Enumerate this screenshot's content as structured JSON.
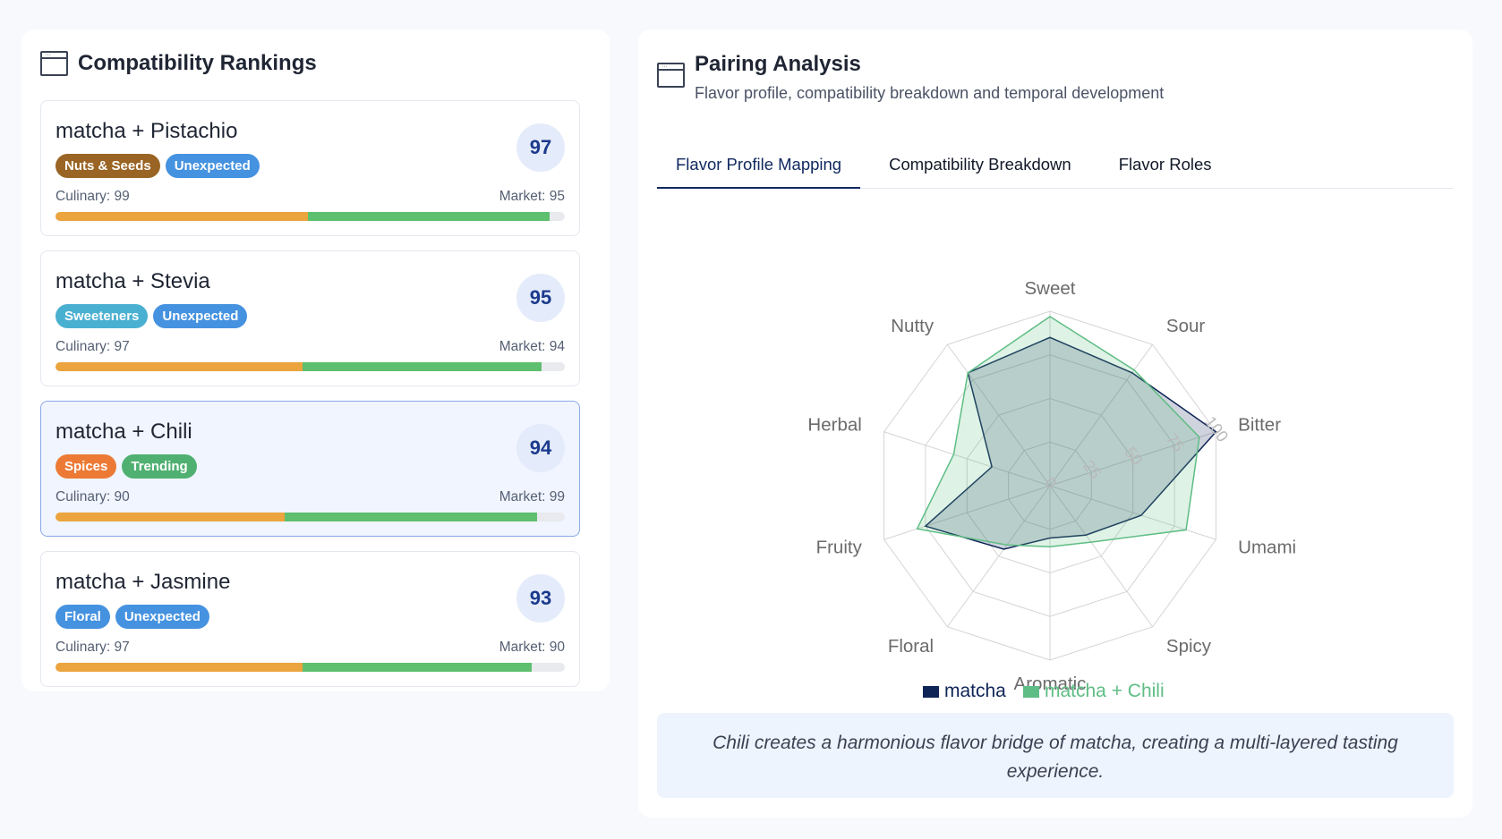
{
  "rankings": {
    "title": "Compatibility Rankings",
    "cards": [
      {
        "title": "matcha + Pistachio",
        "score": "97",
        "tags": [
          {
            "label": "Nuts & Seeds",
            "color": "#9a6424"
          },
          {
            "label": "Unexpected",
            "color": "#4592e0"
          }
        ],
        "culinary_text": "Culinary: 99",
        "market_text": "Market: 95",
        "culinary": 99,
        "market": 95,
        "selected": false
      },
      {
        "title": "matcha + Stevia",
        "score": "95",
        "tags": [
          {
            "label": "Sweeteners",
            "color": "#4ab0d1"
          },
          {
            "label": "Unexpected",
            "color": "#4592e0"
          }
        ],
        "culinary_text": "Culinary: 97",
        "market_text": "Market: 94",
        "culinary": 97,
        "market": 94,
        "selected": false
      },
      {
        "title": "matcha + Chili",
        "score": "94",
        "tags": [
          {
            "label": "Spices",
            "color": "#ec7a35"
          },
          {
            "label": "Trending",
            "color": "#4fb071"
          }
        ],
        "culinary_text": "Culinary: 90",
        "market_text": "Market: 99",
        "culinary": 90,
        "market": 99,
        "selected": true
      },
      {
        "title": "matcha + Jasmine",
        "score": "93",
        "tags": [
          {
            "label": "Floral",
            "color": "#4592e0"
          },
          {
            "label": "Unexpected",
            "color": "#4592e0"
          }
        ],
        "culinary_text": "Culinary: 97",
        "market_text": "Market: 90",
        "culinary": 97,
        "market": 90,
        "selected": false
      }
    ]
  },
  "analysis": {
    "title": "Pairing Analysis",
    "subtitle": "Flavor profile, compatibility breakdown and temporal development",
    "tabs": [
      "Flavor Profile Mapping",
      "Compatibility Breakdown",
      "Flavor Roles"
    ],
    "active_tab": 0,
    "note": "Chili creates a harmonious flavor bridge of matcha, creating a multi-layered tasting experience."
  },
  "chart_data": {
    "type": "radar",
    "axes": [
      "Sweet",
      "Sour",
      "Bitter",
      "Umami",
      "Spicy",
      "Aromatic",
      "Floral",
      "Fruity",
      "Herbal",
      "Nutty"
    ],
    "range": [
      0,
      100
    ],
    "tick_labels": [
      "0",
      "25",
      "50",
      "75",
      "100"
    ],
    "series": [
      {
        "name": "matcha",
        "values": [
          85,
          80,
          100,
          55,
          35,
          30,
          45,
          75,
          35,
          80
        ],
        "color": "#0f2557"
      },
      {
        "name": "matcha + Chili",
        "values": [
          97,
          82,
          90,
          82,
          40,
          35,
          42,
          80,
          58,
          80
        ],
        "color": "#5ebd84"
      }
    ],
    "legend": "bottom"
  }
}
